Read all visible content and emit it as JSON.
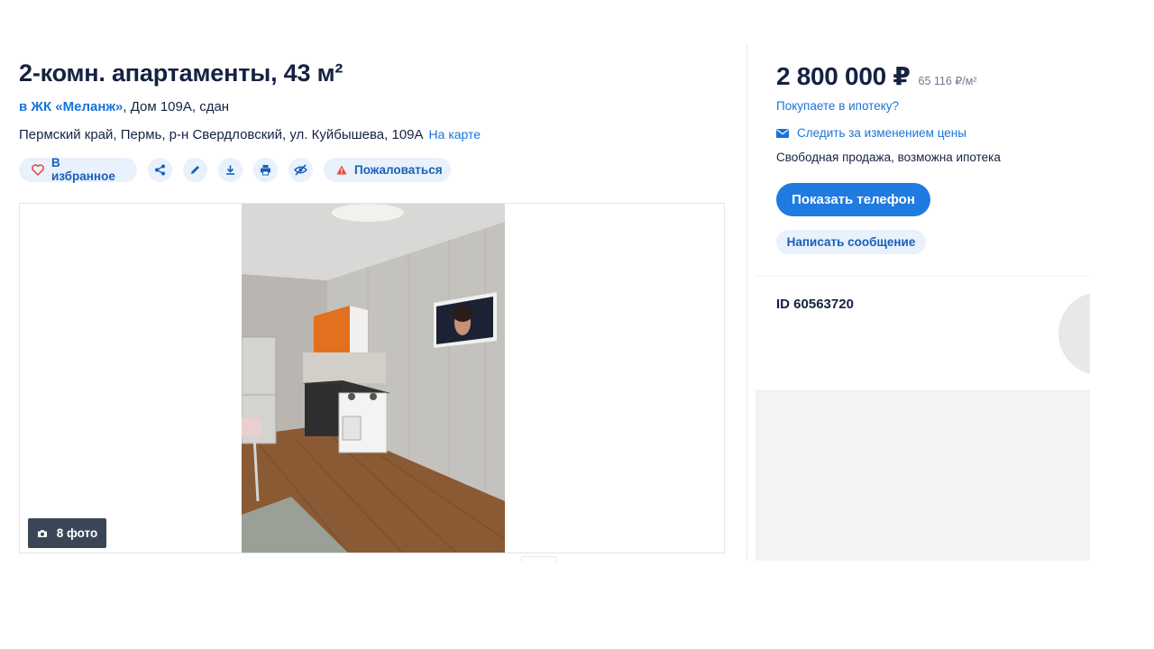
{
  "listing": {
    "title": "2-комн. апартаменты, 43 м²",
    "complex_link": "в ЖК «Меланж»",
    "complex_details": ", Дом 109А, сдан",
    "address": "Пермский край, Пермь, р-н Свердловский, ул. Куйбышева, 109А",
    "map_link": "На карте"
  },
  "actions": {
    "favorite_label": "В избранное",
    "favorite_icon": "heart-icon",
    "share_icon": "share-icon",
    "edit_icon": "pencil-icon",
    "download_icon": "download-icon",
    "print_icon": "printer-icon",
    "hide_icon": "eye-off-icon",
    "report_label": "Пожаловаться",
    "report_icon": "warning-icon"
  },
  "gallery": {
    "photo_count_label": "8 фото",
    "camera_icon": "camera-icon"
  },
  "sidebar": {
    "price": "2 800 000 ₽",
    "price_per_meter": "65 116 ₽/м²",
    "mortgage_link": "Покупаете в ипотеку?",
    "track_price_label": "Следить за изменением цены",
    "track_icon": "envelope-icon",
    "sale_type": "Свободная продажа, возможна ипотека",
    "show_phone_label": "Показать телефон",
    "message_label": "Написать сообщение",
    "listing_id": "ID 60563720"
  },
  "colors": {
    "accent": "#1f7be0",
    "link": "#1a73d9",
    "pill_bg": "#e8f1fc",
    "text": "#152242",
    "danger": "#f0463c"
  }
}
